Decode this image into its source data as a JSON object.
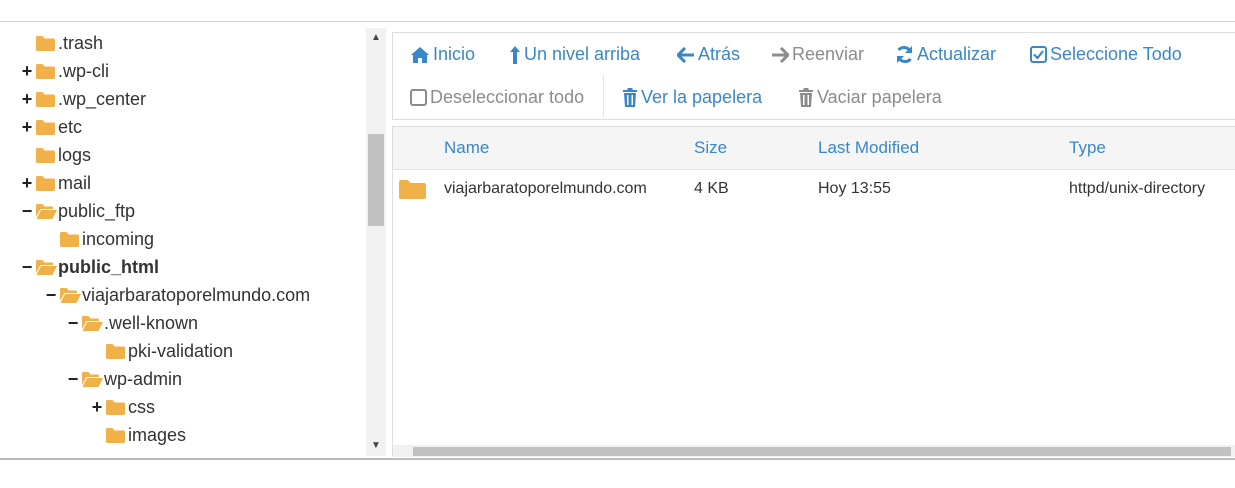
{
  "tree": {
    "items": [
      {
        "label": ".trash",
        "toggle": "",
        "open": false,
        "bold": false
      },
      {
        "label": ".wp-cli",
        "toggle": "+",
        "open": false,
        "bold": false
      },
      {
        "label": ".wp_center",
        "toggle": "+",
        "open": false,
        "bold": false
      },
      {
        "label": "etc",
        "toggle": "+",
        "open": false,
        "bold": false
      },
      {
        "label": "logs",
        "toggle": "",
        "open": false,
        "bold": false
      },
      {
        "label": "mail",
        "toggle": "+",
        "open": false,
        "bold": false
      },
      {
        "label": "public_ftp",
        "toggle": "−",
        "open": true,
        "bold": false
      },
      {
        "label": "incoming",
        "toggle": "",
        "open": false,
        "bold": false
      },
      {
        "label": "public_html",
        "toggle": "−",
        "open": true,
        "bold": true
      },
      {
        "label": "viajarbaratoporelmundo.com",
        "toggle": "−",
        "open": true,
        "bold": false
      },
      {
        "label": ".well-known",
        "toggle": "−",
        "open": true,
        "bold": false
      },
      {
        "label": "pki-validation",
        "toggle": "",
        "open": false,
        "bold": false
      },
      {
        "label": "wp-admin",
        "toggle": "−",
        "open": true,
        "bold": false
      },
      {
        "label": "css",
        "toggle": "+",
        "open": false,
        "bold": false
      },
      {
        "label": "images",
        "toggle": "",
        "open": false,
        "bold": false
      }
    ]
  },
  "toolbar": {
    "home": "Inicio",
    "up": "Un nivel arriba",
    "back": "Atrás",
    "forward": "Reenviar",
    "reload": "Actualizar",
    "select_all": "Seleccione Todo",
    "deselect_all": "Deseleccionar todo",
    "view_trash": "Ver la papelera",
    "empty_trash": "Vaciar papelera"
  },
  "table": {
    "columns": {
      "name": "Name",
      "size": "Size",
      "modified": "Last Modified",
      "type": "Type"
    },
    "rows": [
      {
        "name": "viajarbaratoporelmundo.com",
        "size": "4 KB",
        "modified": "Hoy 13:55",
        "type": "httpd/unix-directory"
      }
    ]
  },
  "colors": {
    "accent": "#3a87c8",
    "folder": "#f0b149",
    "disabled": "#8c8c8c"
  }
}
